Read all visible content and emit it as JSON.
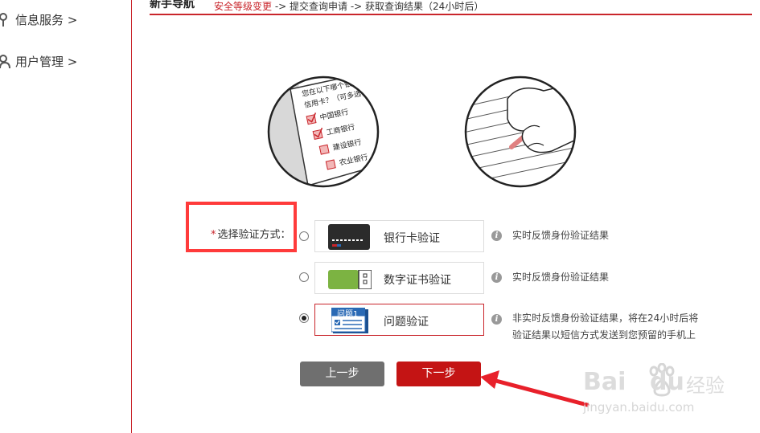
{
  "sidebar": {
    "items": [
      {
        "label": "信息服务 >",
        "icon": "pin-icon"
      },
      {
        "label": "用户管理 >",
        "icon": "user-icon"
      }
    ]
  },
  "header": {
    "title": "新手导航",
    "steps_active": "安全等级变更",
    "steps_rest": " -> 提交查询申请 -> 获取查询结果（24小时后）"
  },
  "illustration": {
    "form_heading_1": "您在以下哪个银",
    "form_heading_2": "信用卡？（可多选",
    "options": [
      "中国银行",
      "工商银行",
      "建设银行",
      "农业银行"
    ],
    "checked": [
      true,
      true,
      false,
      false
    ]
  },
  "form": {
    "required_mark": "*",
    "label": "选择验证方式：",
    "options": [
      {
        "label": "银行卡验证",
        "icon": "bank-card-icon",
        "info_lines": [
          "实时反馈身份验证结果"
        ],
        "selected": false
      },
      {
        "label": "数字证书验证",
        "icon": "digital-certificate-icon",
        "info_lines": [
          "实时反馈身份验证结果"
        ],
        "selected": false
      },
      {
        "label": "问题验证",
        "icon": "question-card-icon",
        "icon_text": "问题1",
        "info_lines": [
          "非实时反馈身份验证结果，将在24小时后将",
          "验证结果以短信方式发送到您预留的手机上"
        ],
        "selected": true
      }
    ],
    "info_icon_glyph": "i"
  },
  "buttons": {
    "prev": "上一步",
    "next": "下一步"
  },
  "watermark": {
    "brand_bai": "Bai",
    "brand_du": "du",
    "brand_cn": "经验",
    "url": "jingyan.baidu.com"
  },
  "colors": {
    "accent": "#c9252b",
    "highlight": "#ff3b3b",
    "prev_button": "#6f6f6f",
    "next_button": "#c41414",
    "arrow": "#e8202a"
  }
}
